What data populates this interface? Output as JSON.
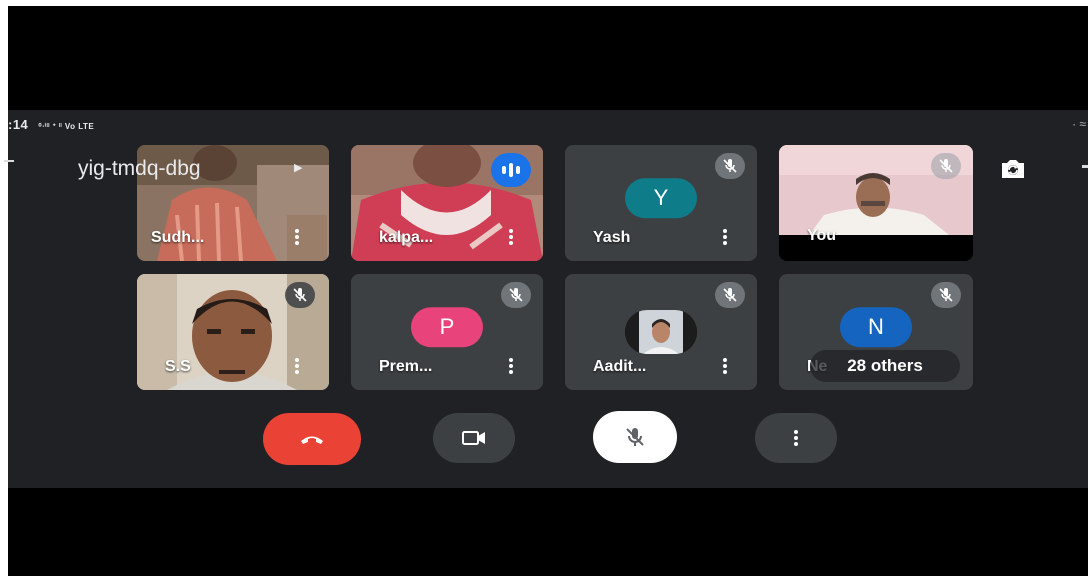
{
  "status_bar": {
    "time": ":14",
    "signal": "⁰ᐧⁱˡˡ ᐩ ˡˡ Vo LTE",
    "right": "· ≈"
  },
  "meeting": {
    "code": "yig-tmdq-dbg"
  },
  "participants": [
    {
      "name": "Sudh...",
      "kind": "video",
      "muted": false
    },
    {
      "name": "kalpa...",
      "kind": "video",
      "muted": false,
      "speaking": true
    },
    {
      "name": "Yash",
      "kind": "initial",
      "initial": "Y",
      "avatar_color": "#0f7c8a",
      "muted": true
    },
    {
      "name": "You",
      "kind": "video",
      "muted": true
    },
    {
      "name": "S.S",
      "kind": "video",
      "muted": true
    },
    {
      "name": "Prem...",
      "kind": "initial",
      "initial": "P",
      "avatar_color": "#e8437b",
      "muted": true
    },
    {
      "name": "Aadit...",
      "kind": "photo",
      "muted": true
    },
    {
      "name": "Ne",
      "kind": "initial",
      "initial": "N",
      "avatar_color": "#1565c0",
      "muted": true
    }
  ],
  "overflow": {
    "label": "28 others"
  },
  "controls": {
    "end_call_color": "#ea4335",
    "icons": [
      "phone-hangup-icon",
      "camera-icon",
      "mic-off-icon",
      "more-vert-icon"
    ]
  }
}
